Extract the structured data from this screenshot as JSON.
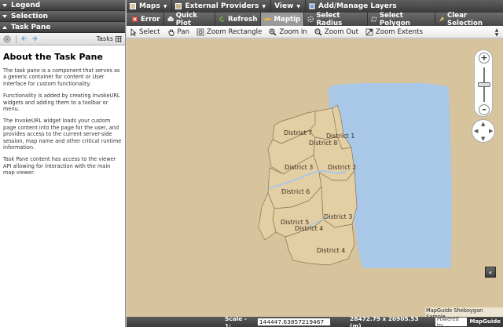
{
  "left_panel": {
    "sections": [
      {
        "label": "Legend"
      },
      {
        "label": "Selection"
      },
      {
        "label": "Task Pane"
      }
    ],
    "toolbar": {
      "tasks_label": "Tasks"
    },
    "title": "About the Task Pane",
    "paragraphs": [
      "The task pane is a component that serves as a generic container for content or User Interface for custom functionality.",
      "Functionality is added by creating InvokeURL widgets and adding them to a toolbar or menu.",
      "The InvokeURL widget loads your custom page content into the page for the user, and provides access to the current server-side session, map name and other critical runtime information.",
      "Task Pane content has access to the viewer API allowing for interaction with the main map viewer."
    ]
  },
  "menubar": {
    "items": [
      {
        "label": "Maps"
      },
      {
        "label": "External Providers"
      },
      {
        "label": "View"
      },
      {
        "label": "Add/Manage Layers"
      }
    ]
  },
  "toolbar1": {
    "buttons": [
      {
        "label": "Error"
      },
      {
        "label": "Quick Plot"
      },
      {
        "label": "Refresh"
      },
      {
        "label": "Maptip"
      },
      {
        "label": "Select Radius"
      },
      {
        "label": "Select Polygon"
      },
      {
        "label": "Clear Selection"
      }
    ],
    "active": "Maptip"
  },
  "toolbar2": {
    "buttons": [
      {
        "label": "Select"
      },
      {
        "label": "Pan"
      },
      {
        "label": "Zoom Rectangle"
      },
      {
        "label": "Zoom In"
      },
      {
        "label": "Zoom Out"
      },
      {
        "label": "Zoom Extents"
      }
    ]
  },
  "map": {
    "districts": [
      {
        "label": "District 1"
      },
      {
        "label": "District 2"
      },
      {
        "label": "District 3"
      },
      {
        "label": "District 3"
      },
      {
        "label": "District 4"
      },
      {
        "label": "District 4"
      },
      {
        "label": "District 5"
      },
      {
        "label": "District 6"
      },
      {
        "label": "District 7"
      },
      {
        "label": "District 8"
      }
    ],
    "caption": "MapGuide Sheboygan Sample",
    "colors": {
      "background": "#d7c39c",
      "water": "#a9c8e8",
      "district_fill": "#e3cfa4",
      "district_stroke": "#8a7452"
    }
  },
  "statusbar": {
    "scale_label": "Scale - 1:",
    "scale_value": "144447.63857219467",
    "coords": "28472.79 x 20905.53 (m)",
    "powered_by": "Powered by",
    "brand": "MapGuide"
  }
}
